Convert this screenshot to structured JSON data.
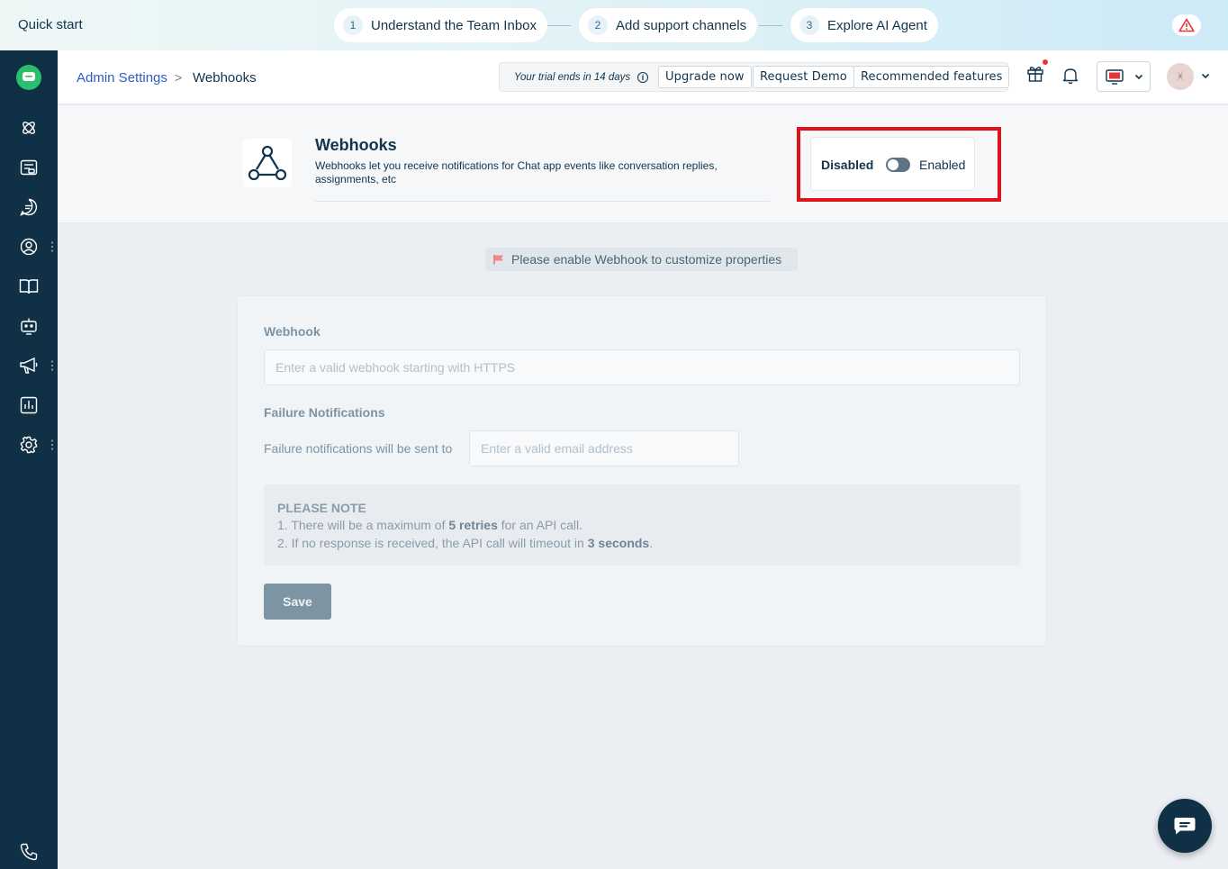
{
  "quick_start": {
    "title": "Quick start",
    "steps": [
      {
        "num": "1",
        "label": "Understand the Team Inbox"
      },
      {
        "num": "2",
        "label": "Add support channels"
      },
      {
        "num": "3",
        "label": "Explore AI Agent"
      }
    ]
  },
  "sidebar": {
    "items": [
      "chat-logo-icon",
      "ai-icon",
      "inbox-icon",
      "conversations-icon",
      "contacts-icon",
      "knowledge-base-icon",
      "bot-icon",
      "campaigns-icon",
      "reports-icon",
      "settings-icon",
      "phone-icon"
    ]
  },
  "header": {
    "breadcrumb_parent": "Admin Settings",
    "breadcrumb_sep": ">",
    "breadcrumb_current": "Webhooks",
    "trial_text": "Your trial ends in 14 days",
    "upgrade_label": "Upgrade now",
    "demo_label": "Request Demo",
    "recommended_label": "Recommended features",
    "avatar_initials": "ᚸ"
  },
  "webhooks": {
    "title": "Webhooks",
    "description": "Webhooks let you receive notifications for Chat app events like conversation replies, assignments, etc",
    "toggle_off_label": "Disabled",
    "toggle_on_label": "Enabled",
    "enabled": false
  },
  "notice": {
    "text": "Please enable Webhook to customize properties"
  },
  "form": {
    "webhook_label": "Webhook",
    "webhook_placeholder": "Enter a valid webhook starting with HTTPS",
    "failure_label": "Failure Notifications",
    "failure_inline_label": "Failure notifications will be sent to",
    "email_placeholder": "Enter a valid email address",
    "note_title": "PLEASE NOTE",
    "note_line1_pre": "1. There will be a maximum of ",
    "note_line1_bold": "5 retries",
    "note_line1_post": " for an API call.",
    "note_line2_pre": "2. If no response is received, the API call will timeout in ",
    "note_line2_bold": "3 seconds",
    "note_line2_post": ".",
    "save_label": "Save"
  },
  "colors": {
    "sidebar_bg": "#0f3045",
    "highlight_border": "#e0131a",
    "link": "#2c5cc5",
    "brand_green": "#2dbd6e"
  }
}
